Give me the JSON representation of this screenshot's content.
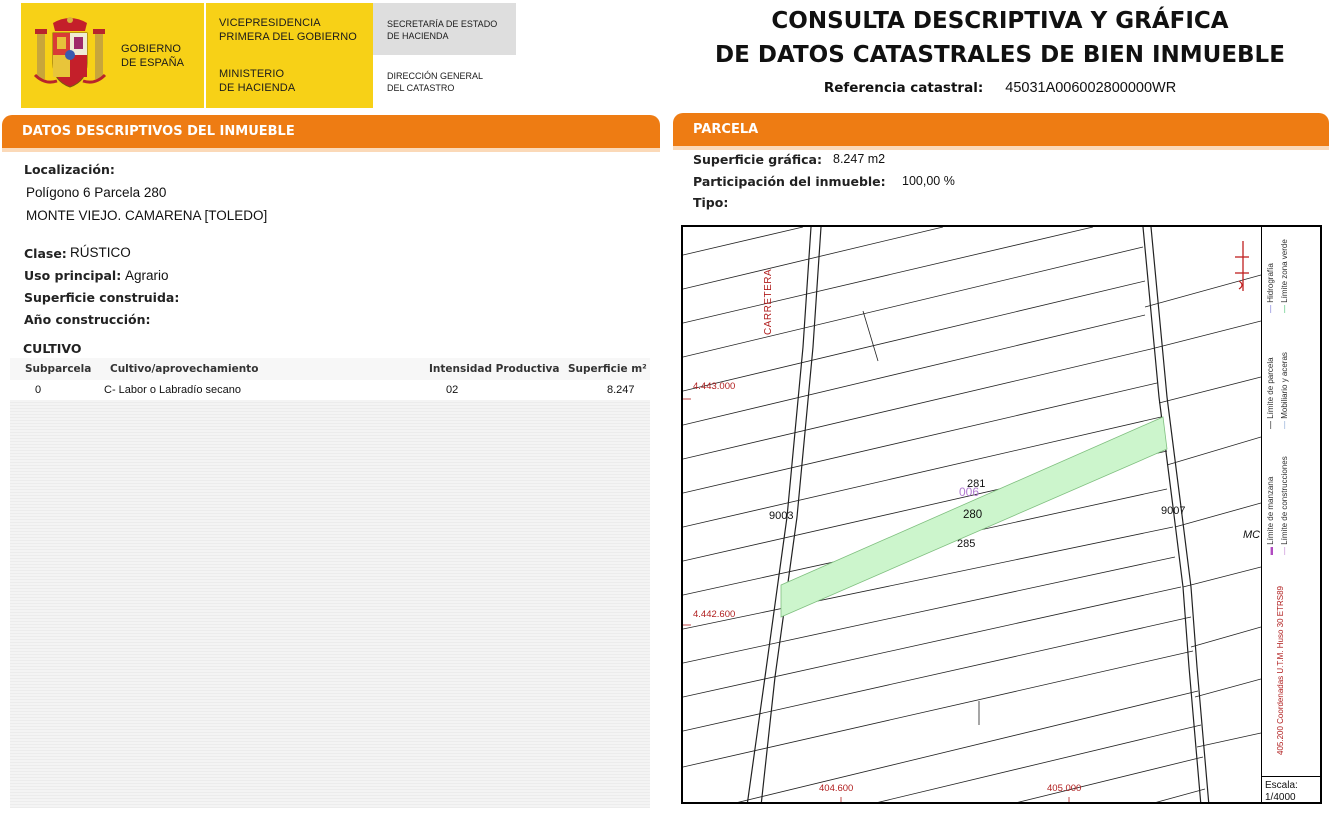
{
  "header": {
    "gobierno": "GOBIERNO\nDE ESPAÑA",
    "vicepresidencia": "VICEPRESIDENCIA\nPRIMERA DEL GOBIERNO",
    "ministerio": "MINISTERIO\nDE HACIENDA",
    "secretaria": "SECRETARÍA DE ESTADO\nDE HACIENDA",
    "direccion": "DIRECCIÓN GENERAL\nDEL CATASTRO",
    "title_line1": "CONSULTA DESCRIPTIVA Y GRÁFICA",
    "title_line2": "DE DATOS CATASTRALES DE BIEN INMUEBLE",
    "ref_label": "Referencia catastral:",
    "ref_value": "45031A006002800000WR"
  },
  "colors": {
    "section_orange": "#ee7c13",
    "logo_yellow": "#f7d117",
    "parcel_fill": "#ccf5cc",
    "coord_red": "#b01e1e"
  },
  "descriptivos": {
    "header": "DATOS DESCRIPTIVOS DEL INMUEBLE",
    "localizacion_label": "Localización:",
    "localizacion_line1": "Polígono 6 Parcela 280",
    "localizacion_line2": "MONTE VIEJO. CAMARENA [TOLEDO]",
    "clase_label": "Clase:",
    "clase_value": "RÚSTICO",
    "uso_label": "Uso principal:",
    "uso_value": "Agrario",
    "superficie_label": "Superficie construida:",
    "anio_label": "Año construcción:",
    "cultivo_label": "CULTIVO",
    "table": {
      "headers": [
        "Subparcela",
        "Cultivo/aprovechamiento",
        "Intensidad Productiva",
        "Superficie m²"
      ],
      "rows": [
        [
          "0",
          "C- Labor o Labradío secano",
          "02",
          "8.247"
        ]
      ]
    }
  },
  "parcela": {
    "header": "PARCELA",
    "superficie_label": "Superficie gráfica:",
    "superficie_value": "8.247 m2",
    "participacion_label": "Participación del inmueble:",
    "participacion_value": "100,00 %",
    "tipo_label": "Tipo:"
  },
  "map": {
    "road_label": "CARRETERA",
    "y_coord_top": "4.443.000",
    "y_coord_bottom": "4.442.600",
    "x_coord_left": "404.600",
    "x_coord_right": "405.000",
    "label_9003": "9003",
    "label_9007": "9007",
    "label_006": "006",
    "label_281": "281",
    "label_280": "280",
    "label_285": "285",
    "label_mo": "MC",
    "legend": {
      "hidrografia": "Hidrografía",
      "limite_zona_verde": "Límite zona verde",
      "limite_parcela": "Límite de parcela",
      "mobiliario": "Mobiliario y aceras",
      "limite_manzana": "Límite de manzana",
      "limite_construcciones": "Límite de construcciones",
      "coordenadas": "405.200 Coordenadas U.T.M. Huso 30 ETRS89"
    },
    "scale_label": "Escala:",
    "scale_value": "1/4000"
  }
}
